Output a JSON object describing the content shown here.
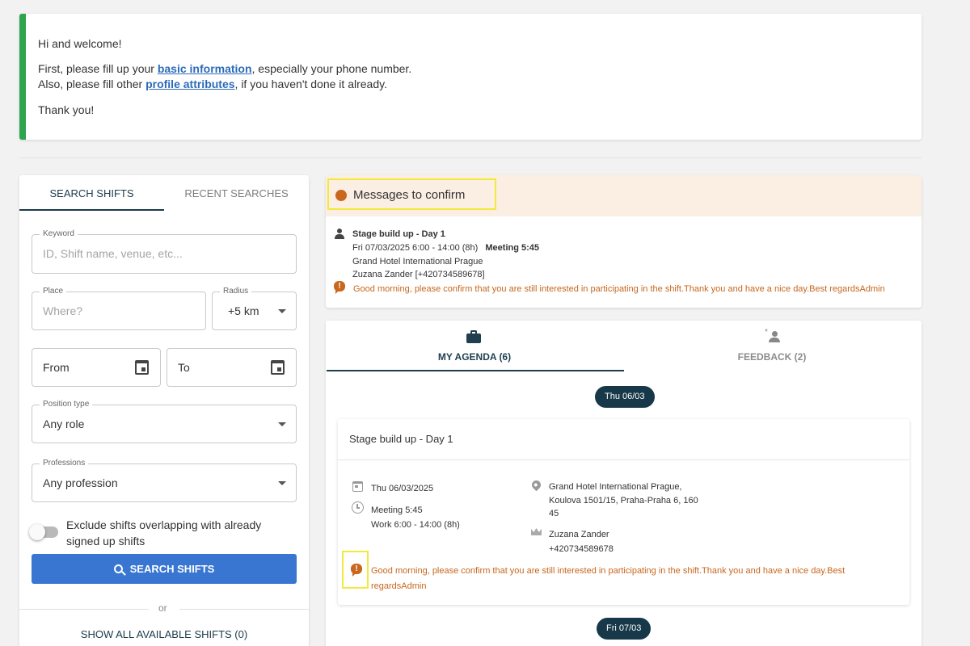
{
  "welcome": {
    "greeting": "Hi and welcome!",
    "line1_prefix": "First, please fill up your ",
    "line1_link": "basic information",
    "line1_suffix": ", especially your phone number.",
    "line2_prefix": "Also, please fill other ",
    "line2_link": "profile attributes",
    "line2_suffix": ", if you haven't done it already.",
    "thanks": "Thank you!"
  },
  "search": {
    "tabs": [
      "SEARCH SHIFTS",
      "RECENT SEARCHES"
    ],
    "keyword": {
      "label": "Keyword",
      "placeholder": "ID, Shift name, venue, etc..."
    },
    "place": {
      "label": "Place",
      "placeholder": "Where?"
    },
    "radius": {
      "label": "Radius",
      "value": "+5 km"
    },
    "from": {
      "value": "From"
    },
    "to": {
      "value": "To"
    },
    "position_type": {
      "label": "Position type",
      "value": "Any role"
    },
    "professions": {
      "label": "Professions",
      "value": "Any profession"
    },
    "exclude_toggle": {
      "label": "Exclude shifts overlapping with already signed up shifts"
    },
    "search_button": "SEARCH SHIFTS",
    "or_text": "or",
    "show_all": "SHOW ALL AVAILABLE SHIFTS (0)"
  },
  "messages": {
    "title": "Messages to confirm",
    "item": {
      "shift_name": "Stage build up - Day 1",
      "datetime": "Fri 07/03/2025  6:00 - 14:00 (8h)",
      "meeting": "Meeting 5:45",
      "venue": "Grand Hotel International Prague",
      "contact": "Zuzana Zander [+420734589678]",
      "message": "Good morning, please confirm that you are still interested in participating in the shift.Thank you and have a nice day.Best regardsAdmin"
    }
  },
  "agenda": {
    "tabs": [
      "MY AGENDA (6)",
      "FEEDBACK (2)"
    ],
    "dates": [
      "Thu 06/03",
      "Fri 07/03"
    ],
    "card": {
      "title": "Stage build up - Day 1",
      "date": "Thu 06/03/2025",
      "meeting": "Meeting 5:45",
      "work": "Work 6:00 - 14:00 (8h)",
      "address_1": "Grand Hotel International Prague,",
      "address_2": "Koulova 1501/15, Praha-Praha 6, 160",
      "address_3": "45",
      "contact_name": "Zuzana Zander",
      "contact_phone": "+420734589678",
      "message_1": "Good morning, please confirm that you are still interested in participating in the shift.Thank you and have a nice day.Best",
      "message_2": "regardsAdmin"
    }
  },
  "colors": {
    "accent_green": "#2ea44f",
    "primary_blue": "#3876d1",
    "navy": "#163848",
    "warning_orange": "#c8671d",
    "highlight_yellow": "#f2e93b"
  }
}
